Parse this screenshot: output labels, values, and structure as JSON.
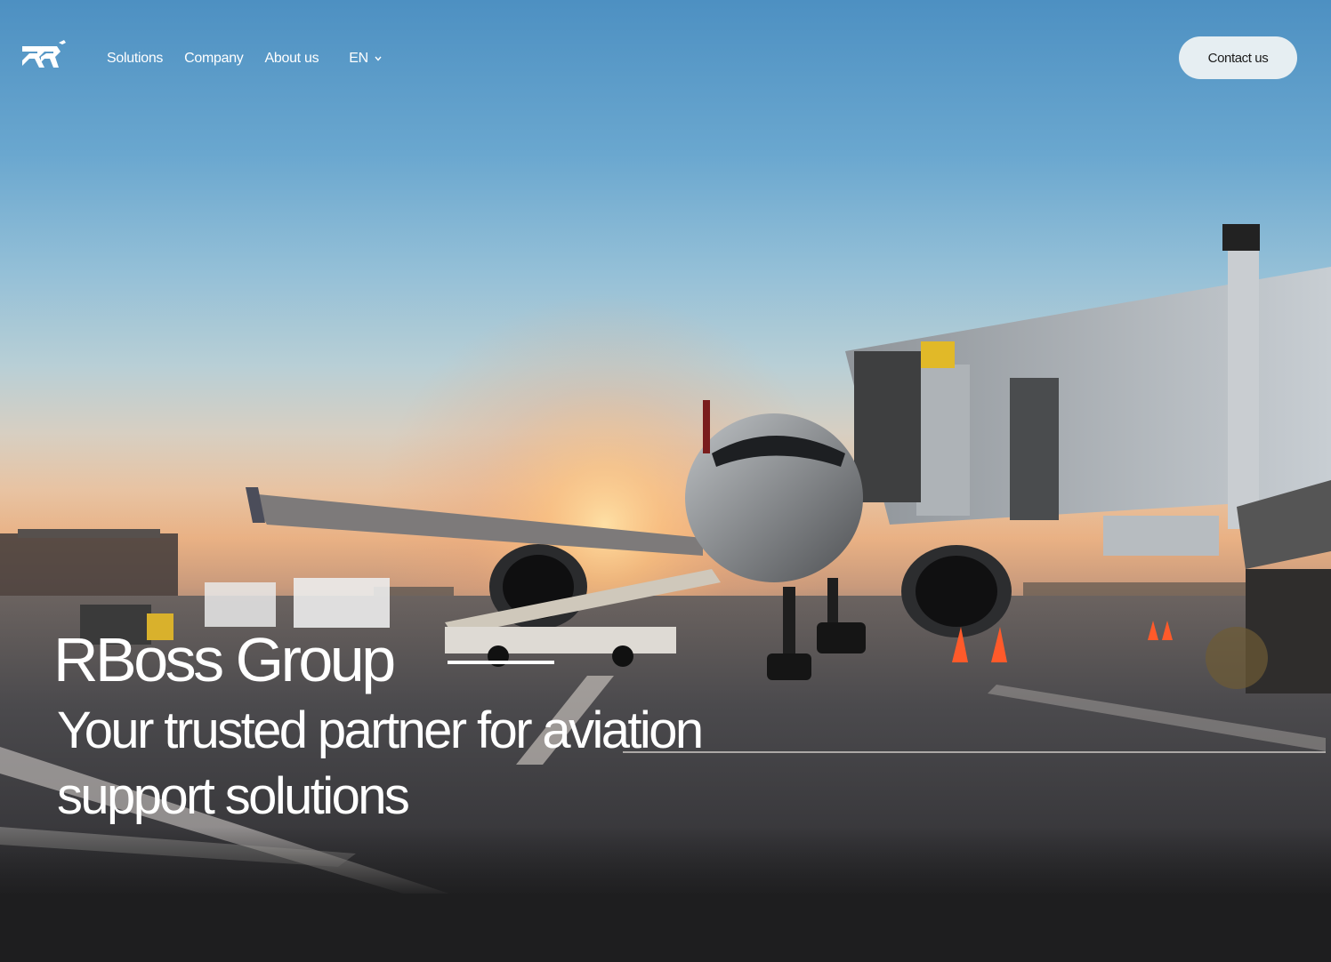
{
  "nav": {
    "logo_alt": "RBoss Group logo",
    "links": [
      {
        "label": "Solutions"
      },
      {
        "label": "Company"
      },
      {
        "label": "About us"
      }
    ],
    "language": "EN",
    "contact_label": "Contact us"
  },
  "hero": {
    "title": "RBoss Group",
    "tagline": "Your trusted partner for aviation support solutions",
    "image_subject": "airplane-at-gate-sunset"
  },
  "colors": {
    "button_bg": "#e6eef2",
    "footer_bg": "#1e1e1f",
    "text": "#ffffff"
  },
  "icons": [
    "logo-icon",
    "chevron-down-icon"
  ]
}
